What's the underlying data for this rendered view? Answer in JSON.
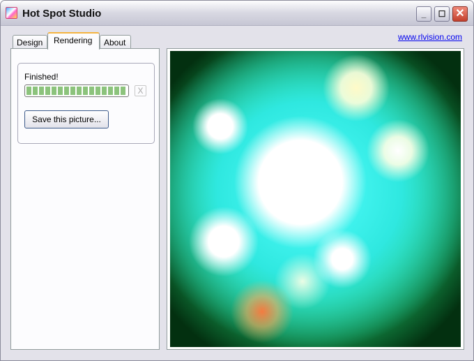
{
  "window": {
    "title": "Hot Spot Studio",
    "minimize": "_",
    "maximize": "☐",
    "close": "✕"
  },
  "link": "www.rlvision.com",
  "tabs": [
    {
      "label": "Design"
    },
    {
      "label": "Rendering"
    },
    {
      "label": "About"
    }
  ],
  "active_tab": "Rendering",
  "render_panel": {
    "status": "Finished!",
    "progress_percent": 100,
    "cancel_label": "X",
    "save_label": "Save this picture..."
  },
  "colors": {
    "accent_tab": "#f5b440",
    "progress": "#8cc37c",
    "close": "#c33f2c"
  }
}
